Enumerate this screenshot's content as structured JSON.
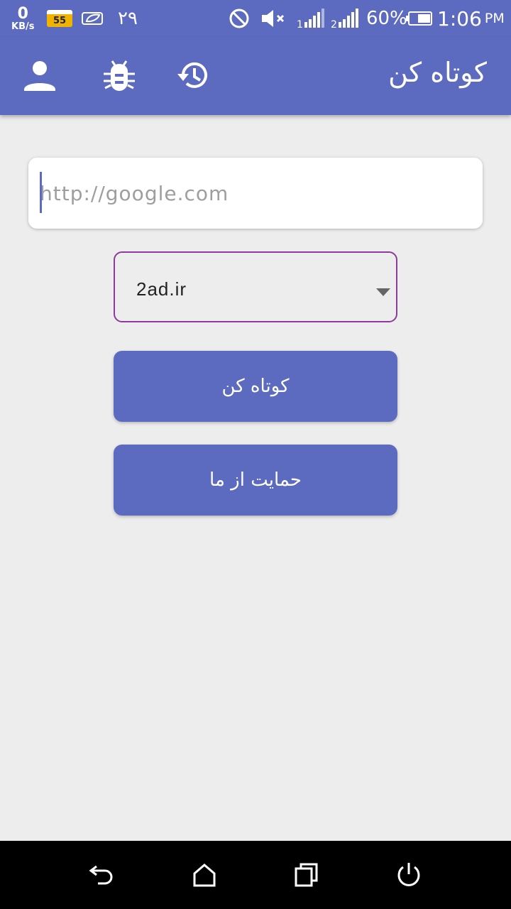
{
  "status_bar": {
    "net_speed_value": "0",
    "net_speed_unit": "KB/s",
    "badge_text": "55",
    "day": "۲۹",
    "battery_percent": "60%",
    "time": "1:06",
    "ampm": "PM"
  },
  "app_bar": {
    "title": "کوتاه کن",
    "icons": [
      "account-icon",
      "bug-icon",
      "history-icon"
    ]
  },
  "url_input": {
    "placeholder": "http://google.com",
    "value": ""
  },
  "domain_select": {
    "selected": "2ad.ir"
  },
  "buttons": {
    "shorten_label": "کوتاه کن",
    "support_label": "حمایت از ما"
  },
  "nav_bar": {
    "icons": [
      "back-icon",
      "home-icon",
      "recents-icon",
      "power-icon"
    ]
  },
  "colors": {
    "primary": "#5c6bc0",
    "dropdown_border": "#8e3a9e",
    "background": "#ededed"
  }
}
